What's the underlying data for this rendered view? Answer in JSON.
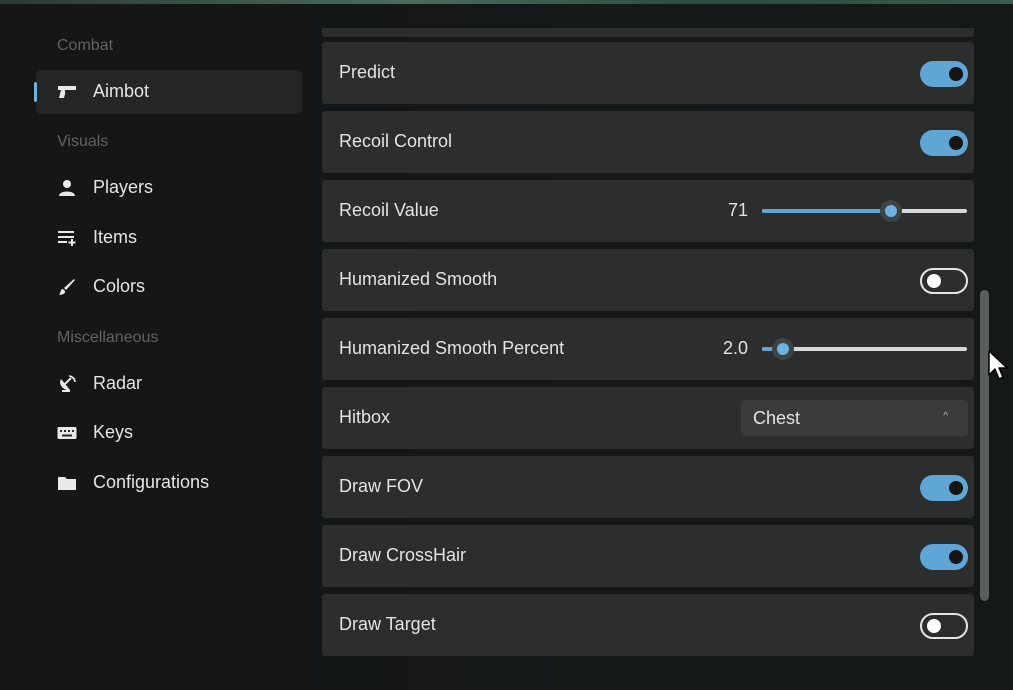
{
  "sidebar": {
    "sections": [
      {
        "label": "Combat"
      },
      {
        "label": "Visuals"
      },
      {
        "label": "Miscellaneous"
      }
    ],
    "items": [
      {
        "label": "Aimbot",
        "icon": "gun-icon",
        "active": true
      },
      {
        "label": "Players",
        "icon": "person-icon"
      },
      {
        "label": "Items",
        "icon": "list-add-icon"
      },
      {
        "label": "Colors",
        "icon": "brush-icon"
      },
      {
        "label": "Radar",
        "icon": "satellite-dish-icon"
      },
      {
        "label": "Keys",
        "icon": "keyboard-icon"
      },
      {
        "label": "Configurations",
        "icon": "folder-icon"
      }
    ]
  },
  "settings": {
    "predict": {
      "label": "Predict",
      "enabled": true
    },
    "recoil_control": {
      "label": "Recoil Control",
      "enabled": true
    },
    "recoil_value": {
      "label": "Recoil Value",
      "value": "71",
      "fraction": 0.63
    },
    "humanized_smooth": {
      "label": "Humanized Smooth",
      "enabled": false
    },
    "humanized_smooth_percent": {
      "label": "Humanized Smooth Percent",
      "value": "2.0",
      "fraction": 0.1
    },
    "hitbox": {
      "label": "Hitbox",
      "value": "Chest",
      "caret": "^"
    },
    "draw_fov": {
      "label": "Draw FOV",
      "enabled": true
    },
    "draw_crosshair": {
      "label": "Draw CrossHair",
      "enabled": true
    },
    "draw_target": {
      "label": "Draw Target",
      "enabled": false
    }
  },
  "colors": {
    "accent": "#5fa5d6",
    "row_bg": "#2c2d2d",
    "sidebar_bg": "#161717"
  }
}
